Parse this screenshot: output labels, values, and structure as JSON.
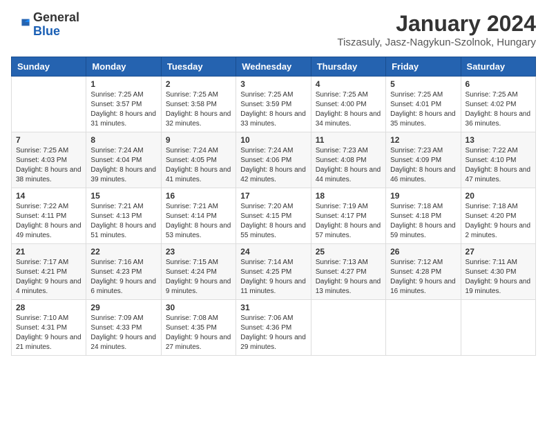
{
  "logo": {
    "general": "General",
    "blue": "Blue"
  },
  "header": {
    "title": "January 2024",
    "subtitle": "Tiszasuly, Jasz-Nagykun-Szolnok, Hungary"
  },
  "days_of_week": [
    "Sunday",
    "Monday",
    "Tuesday",
    "Wednesday",
    "Thursday",
    "Friday",
    "Saturday"
  ],
  "weeks": [
    [
      {
        "day": "",
        "info": ""
      },
      {
        "day": "1",
        "info": "Sunrise: 7:25 AM\nSunset: 3:57 PM\nDaylight: 8 hours and 31 minutes."
      },
      {
        "day": "2",
        "info": "Sunrise: 7:25 AM\nSunset: 3:58 PM\nDaylight: 8 hours and 32 minutes."
      },
      {
        "day": "3",
        "info": "Sunrise: 7:25 AM\nSunset: 3:59 PM\nDaylight: 8 hours and 33 minutes."
      },
      {
        "day": "4",
        "info": "Sunrise: 7:25 AM\nSunset: 4:00 PM\nDaylight: 8 hours and 34 minutes."
      },
      {
        "day": "5",
        "info": "Sunrise: 7:25 AM\nSunset: 4:01 PM\nDaylight: 8 hours and 35 minutes."
      },
      {
        "day": "6",
        "info": "Sunrise: 7:25 AM\nSunset: 4:02 PM\nDaylight: 8 hours and 36 minutes."
      }
    ],
    [
      {
        "day": "7",
        "info": "Sunrise: 7:25 AM\nSunset: 4:03 PM\nDaylight: 8 hours and 38 minutes."
      },
      {
        "day": "8",
        "info": "Sunrise: 7:24 AM\nSunset: 4:04 PM\nDaylight: 8 hours and 39 minutes."
      },
      {
        "day": "9",
        "info": "Sunrise: 7:24 AM\nSunset: 4:05 PM\nDaylight: 8 hours and 41 minutes."
      },
      {
        "day": "10",
        "info": "Sunrise: 7:24 AM\nSunset: 4:06 PM\nDaylight: 8 hours and 42 minutes."
      },
      {
        "day": "11",
        "info": "Sunrise: 7:23 AM\nSunset: 4:08 PM\nDaylight: 8 hours and 44 minutes."
      },
      {
        "day": "12",
        "info": "Sunrise: 7:23 AM\nSunset: 4:09 PM\nDaylight: 8 hours and 46 minutes."
      },
      {
        "day": "13",
        "info": "Sunrise: 7:22 AM\nSunset: 4:10 PM\nDaylight: 8 hours and 47 minutes."
      }
    ],
    [
      {
        "day": "14",
        "info": "Sunrise: 7:22 AM\nSunset: 4:11 PM\nDaylight: 8 hours and 49 minutes."
      },
      {
        "day": "15",
        "info": "Sunrise: 7:21 AM\nSunset: 4:13 PM\nDaylight: 8 hours and 51 minutes."
      },
      {
        "day": "16",
        "info": "Sunrise: 7:21 AM\nSunset: 4:14 PM\nDaylight: 8 hours and 53 minutes."
      },
      {
        "day": "17",
        "info": "Sunrise: 7:20 AM\nSunset: 4:15 PM\nDaylight: 8 hours and 55 minutes."
      },
      {
        "day": "18",
        "info": "Sunrise: 7:19 AM\nSunset: 4:17 PM\nDaylight: 8 hours and 57 minutes."
      },
      {
        "day": "19",
        "info": "Sunrise: 7:18 AM\nSunset: 4:18 PM\nDaylight: 8 hours and 59 minutes."
      },
      {
        "day": "20",
        "info": "Sunrise: 7:18 AM\nSunset: 4:20 PM\nDaylight: 9 hours and 2 minutes."
      }
    ],
    [
      {
        "day": "21",
        "info": "Sunrise: 7:17 AM\nSunset: 4:21 PM\nDaylight: 9 hours and 4 minutes."
      },
      {
        "day": "22",
        "info": "Sunrise: 7:16 AM\nSunset: 4:23 PM\nDaylight: 9 hours and 6 minutes."
      },
      {
        "day": "23",
        "info": "Sunrise: 7:15 AM\nSunset: 4:24 PM\nDaylight: 9 hours and 9 minutes."
      },
      {
        "day": "24",
        "info": "Sunrise: 7:14 AM\nSunset: 4:25 PM\nDaylight: 9 hours and 11 minutes."
      },
      {
        "day": "25",
        "info": "Sunrise: 7:13 AM\nSunset: 4:27 PM\nDaylight: 9 hours and 13 minutes."
      },
      {
        "day": "26",
        "info": "Sunrise: 7:12 AM\nSunset: 4:28 PM\nDaylight: 9 hours and 16 minutes."
      },
      {
        "day": "27",
        "info": "Sunrise: 7:11 AM\nSunset: 4:30 PM\nDaylight: 9 hours and 19 minutes."
      }
    ],
    [
      {
        "day": "28",
        "info": "Sunrise: 7:10 AM\nSunset: 4:31 PM\nDaylight: 9 hours and 21 minutes."
      },
      {
        "day": "29",
        "info": "Sunrise: 7:09 AM\nSunset: 4:33 PM\nDaylight: 9 hours and 24 minutes."
      },
      {
        "day": "30",
        "info": "Sunrise: 7:08 AM\nSunset: 4:35 PM\nDaylight: 9 hours and 27 minutes."
      },
      {
        "day": "31",
        "info": "Sunrise: 7:06 AM\nSunset: 4:36 PM\nDaylight: 9 hours and 29 minutes."
      },
      {
        "day": "",
        "info": ""
      },
      {
        "day": "",
        "info": ""
      },
      {
        "day": "",
        "info": ""
      }
    ]
  ]
}
